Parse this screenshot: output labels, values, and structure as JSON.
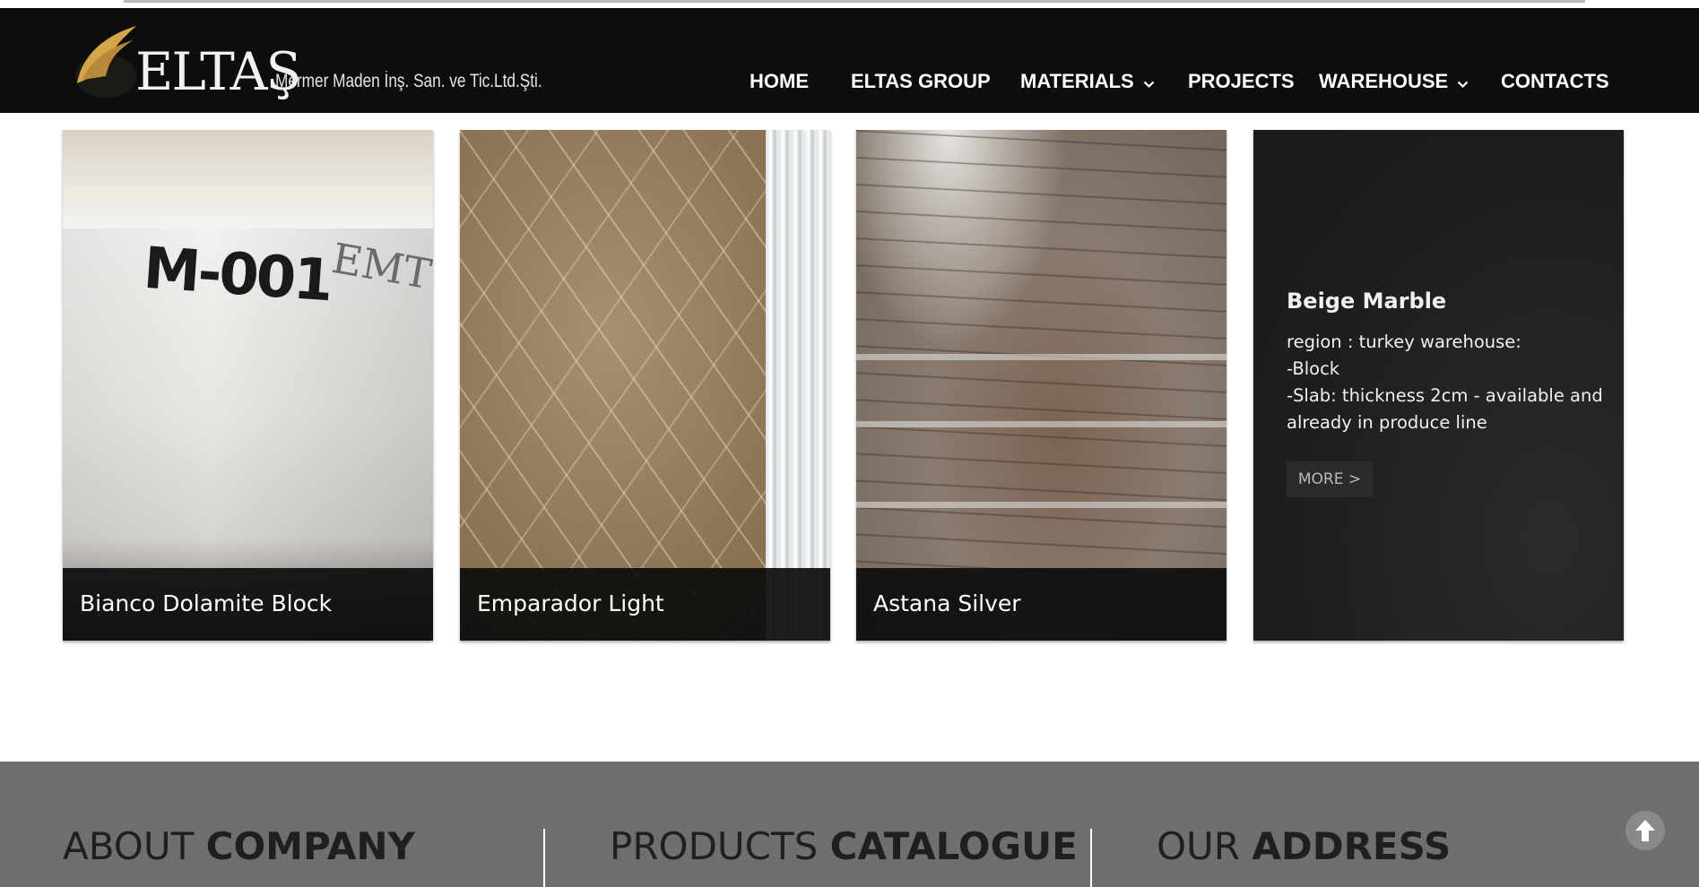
{
  "header": {
    "logo": {
      "wordmark": "ELTAŞ",
      "subtitle": "Mermer Maden İnş. San. ve Tic.Ltd.Şti."
    },
    "nav": [
      {
        "label": "HOME",
        "has_dropdown": false
      },
      {
        "label": "ELTAS GROUP",
        "has_dropdown": false
      },
      {
        "label": "MATERIALS",
        "has_dropdown": true
      },
      {
        "label": "PROJECTS",
        "has_dropdown": false
      },
      {
        "label": "WAREHOUSE",
        "has_dropdown": true
      },
      {
        "label": "CONTACTS",
        "has_dropdown": false
      }
    ]
  },
  "cards": [
    {
      "caption": "Bianco Dolamite Block"
    },
    {
      "caption": "Emparador Light"
    },
    {
      "caption": "Astana Silver"
    },
    {
      "title": "Beige Marble",
      "lines": [
        "region : turkey warehouse:",
        "-Block",
        "-Slab: thickness 2cm - available and",
        "already in produce line"
      ],
      "more_label": "MORE >"
    }
  ],
  "footer": {
    "columns": [
      {
        "light": "ABOUT ",
        "bold": "COMPANY"
      },
      {
        "light": "PRODUCTS ",
        "bold": "CATALOGUE"
      },
      {
        "light": "OUR ",
        "bold": "ADDRESS"
      }
    ]
  },
  "colors": {
    "header_bg": "#0d0d0d",
    "footer_bg": "#6f6f6f",
    "logo_gold": "#d4a64a"
  },
  "icons": {
    "scroll_top": "arrow-up-icon",
    "dropdown": "chevron-down-icon"
  }
}
